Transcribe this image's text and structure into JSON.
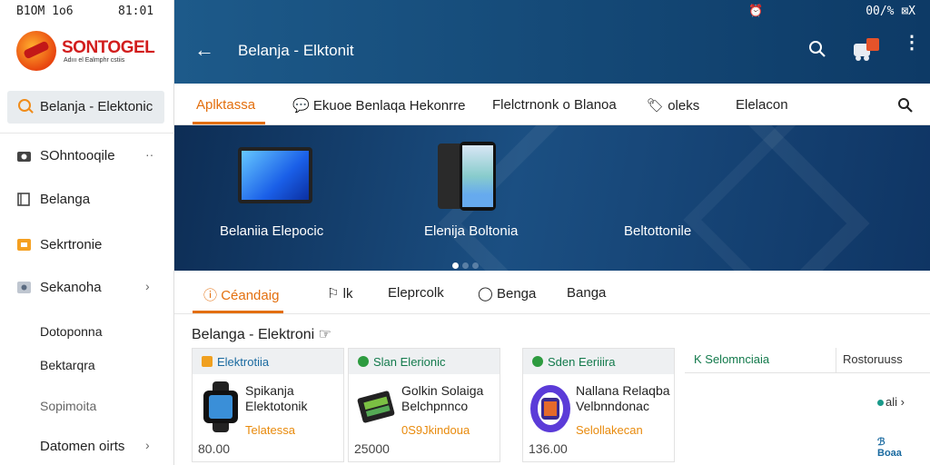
{
  "status_bar": {
    "left": "B1OM 1o6",
    "left_time": "81:01",
    "right": "00/% ⊠X"
  },
  "sidebar": {
    "logo_title": "SONTOGEL",
    "logo_sub": "Adııı el Ealmphr cstiis",
    "active_item": "Belanja - Elektonic",
    "items": [
      {
        "label": "SOhntooqile",
        "icon": "camera-icon",
        "chevron": "··"
      },
      {
        "label": "Belanga",
        "icon": "document-icon",
        "chevron": ""
      },
      {
        "label": "Sekrtronie",
        "icon": "store-icon",
        "chevron": ""
      },
      {
        "label": "Sekanoha",
        "icon": "image-icon",
        "chevron": "›"
      }
    ],
    "sub_items": [
      {
        "label": "Dotoponna"
      },
      {
        "label": "Bektarqra"
      },
      {
        "label": "Sopimoita"
      },
      {
        "label": "Datomen oirts",
        "chevron": "›"
      }
    ]
  },
  "header": {
    "title": "Belanja - Elktonit",
    "back_label": "←",
    "more_label": "⋮"
  },
  "tabs": [
    {
      "label": "Aplktassa"
    },
    {
      "label": "Ekuoe Benlaqa Hekonrre"
    },
    {
      "label": "Flelctrnonk o Blanoa"
    },
    {
      "label": "oleks"
    },
    {
      "label": "Elelacon"
    }
  ],
  "banner": {
    "items": [
      {
        "label": "Belaniia Elepocic"
      },
      {
        "label": "Elenija Boltonia"
      },
      {
        "label": "Beltottonile"
      }
    ]
  },
  "subtabs": [
    {
      "label": "Céandaig"
    },
    {
      "label": "lk"
    },
    {
      "label": "Eleprcolk"
    },
    {
      "label": "Benga"
    },
    {
      "label": "Banga"
    }
  ],
  "section_title": "Belanga - Elektroni",
  "cards": [
    {
      "header": "Elektrotiia",
      "name": "Spikanja Elektotonik",
      "sub": "Telatessa",
      "price": "80.00"
    },
    {
      "header": "Slan Elerionic",
      "name": "Golkin Solaiga Belchpnnco",
      "sub": "0S9Jkindoua",
      "price": "25000"
    },
    {
      "header": "Sden Eeriiira",
      "name": "Nallana Relaqba Velbnndonac",
      "sub": "Selollakecan",
      "price": "136.00"
    }
  ],
  "extra": {
    "head_a": "K Selomnciaia",
    "head_b": "Rostoruuss",
    "more": "ali ›",
    "brand": "Boaa"
  },
  "colors": {
    "accent": "#e36f0e",
    "header_bg": "#0d3a66",
    "green": "#137a4c"
  }
}
